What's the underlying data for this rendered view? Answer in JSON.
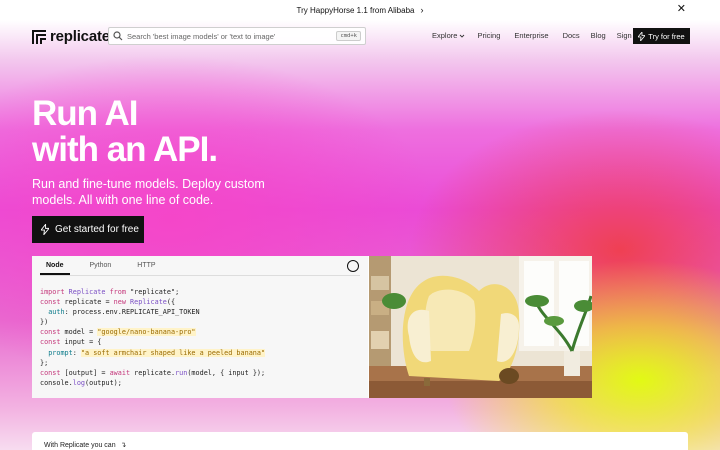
{
  "announcement": {
    "text": "Try HappyHorse 1.1 from Alibaba",
    "arrow_icon": "chevron-right-icon",
    "close_icon": "close-icon"
  },
  "nav": {
    "logo_text": "replicate",
    "search_placeholder": "Search 'best image models' or 'text to image'",
    "search_shortcut": "cmd+k",
    "links": [
      "Explore",
      "Pricing",
      "Enterprise",
      "Docs",
      "Blog",
      "Sign in"
    ],
    "cta_label": "Try for free"
  },
  "hero": {
    "title_line1": "Run AI",
    "title_line2": "with an API.",
    "subtitle": "Run and fine-tune models. Deploy custom models. All with one line of code.",
    "cta_label": "Get started for free"
  },
  "code_panel": {
    "tabs": [
      "Node",
      "Python",
      "HTTP"
    ],
    "active_tab": "Node",
    "lines": [
      "import Replicate from \"replicate\";",
      "const replicate = new Replicate({",
      "  auth: process.env.REPLICATE_API_TOKEN",
      "})",
      "const model = \"google/nano-banana-pro\"",
      "const input = {",
      "  prompt: \"a soft armchair shaped like a peeled banana\"",
      "};",
      "const [output] = await replicate.run(model, { input });",
      "console.log(output);"
    ]
  },
  "bottom": {
    "text": "With Replicate you can"
  },
  "colors": {
    "accent_dark": "#111111",
    "hero_pink": "#ea4bd7",
    "hero_yellow": "#e1ff0a"
  }
}
